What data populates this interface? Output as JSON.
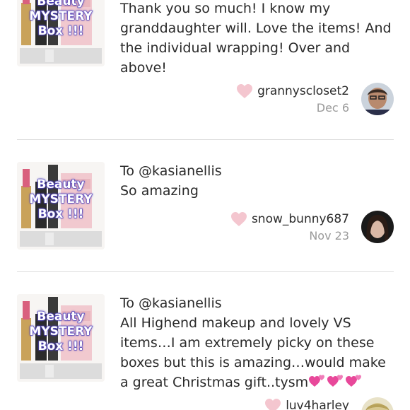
{
  "reviews": [
    {
      "thumb_caption": [
        "Beauty",
        "MYSTERY",
        "Box !!!"
      ],
      "recipient": "",
      "text": "Thank you so much! I know my granddaughter will. Love the items! And the individual wrapping! Over and above!",
      "username": "grannyscloset2",
      "date": "Dec 6"
    },
    {
      "thumb_caption": [
        "Beauty",
        "MYSTERY",
        "Box !!!"
      ],
      "recipient": "To @kasianellis",
      "text": "So amazing",
      "username": "snow_bunny687",
      "date": "Nov 23"
    },
    {
      "thumb_caption": [
        "Beauty",
        "MYSTERY",
        "Box !!!"
      ],
      "recipient": "To @kasianellis",
      "text": "All Highend makeup and lovely VS items…I am extremely picky on these boxes but this is amazing…would make a great Christmas gift..tysm",
      "username": "luv4harley",
      "date": ""
    }
  ],
  "colors": {
    "heart": "#f4c6cf",
    "divider": "#dcdcdc",
    "date": "#9a9a9a",
    "caption_outline": "#5a4fc4",
    "emoji_heart": "#e8489a"
  },
  "icons": {
    "like": "heart-icon",
    "emoji": "two-hearts-emoji"
  }
}
